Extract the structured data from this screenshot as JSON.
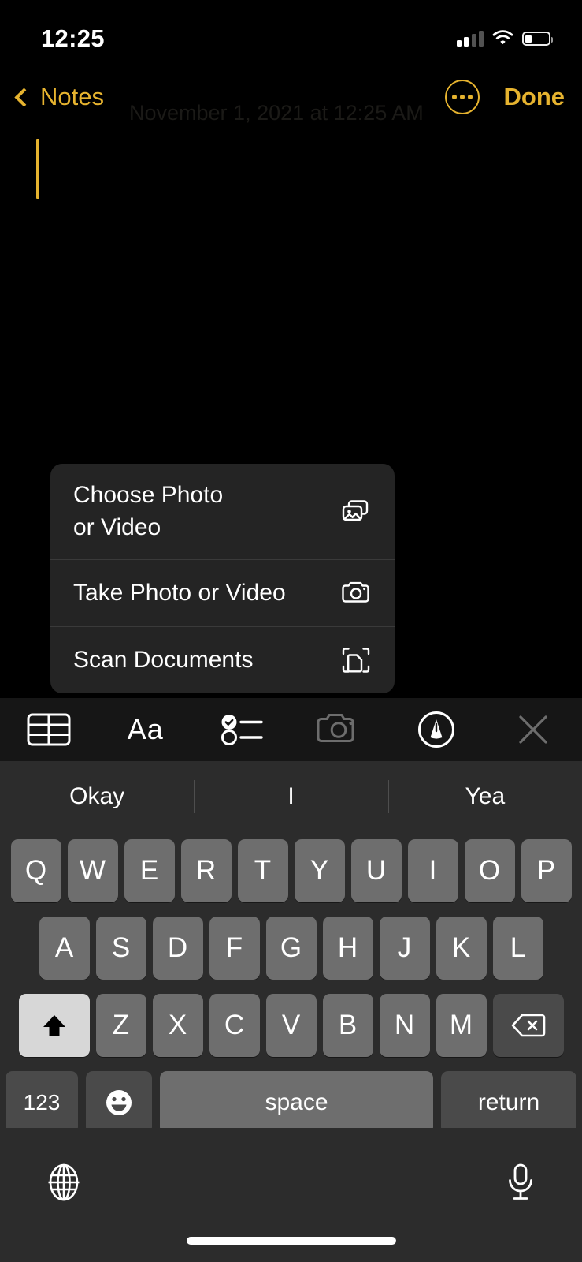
{
  "theme": {
    "accent_color": "#E6B32F",
    "background": "#000000",
    "menu_background": "#242424",
    "key_background": "#6E6E6E",
    "keyboard_background": "#2C2C2C"
  },
  "status_bar": {
    "time": "12:25",
    "cellular_icon": "signal-bars-icon",
    "cellular_bars_filled": 2,
    "cellular_bars_total": 4,
    "wifi_icon": "wifi-icon",
    "battery_icon": "battery-icon",
    "battery_level_percent": 30
  },
  "nav_bar": {
    "back_icon": "chevron-left-icon",
    "back_label": "Notes",
    "more_icon": "ellipsis-circle-icon",
    "done_label": "Done"
  },
  "note": {
    "date_text": "November 1, 2021 at 12:25 AM",
    "body_text": "",
    "caret_visible": true
  },
  "context_menu": {
    "items": [
      {
        "label": "Choose Photo\nor Video",
        "label_line1": "Choose Photo",
        "label_line2": "or Video",
        "icon": "photo-stack-icon",
        "multiline": true
      },
      {
        "label": "Take Photo or Video",
        "icon": "camera-icon",
        "multiline": false
      },
      {
        "label": "Scan Documents",
        "icon": "document-scan-icon",
        "multiline": false
      }
    ]
  },
  "format_toolbar": {
    "items": [
      {
        "name": "table-icon",
        "label": "Table",
        "state": "enabled"
      },
      {
        "name": "text-format-icon",
        "label": "Aa",
        "state": "enabled"
      },
      {
        "name": "checklist-icon",
        "label": "Checklist",
        "state": "enabled"
      },
      {
        "name": "camera-icon",
        "label": "Camera",
        "state": "dimmed"
      },
      {
        "name": "markup-pen-icon",
        "label": "Markup",
        "state": "enabled"
      },
      {
        "name": "close-icon",
        "label": "Close",
        "state": "dimmed"
      }
    ]
  },
  "keyboard": {
    "predictions": [
      "Okay",
      "I",
      "Yea"
    ],
    "row1": [
      "Q",
      "W",
      "E",
      "R",
      "T",
      "Y",
      "U",
      "I",
      "O",
      "P"
    ],
    "row2": [
      "A",
      "S",
      "D",
      "F",
      "G",
      "H",
      "J",
      "K",
      "L"
    ],
    "row3": [
      "Z",
      "X",
      "C",
      "V",
      "B",
      "N",
      "M"
    ],
    "shift_icon": "shift-up-arrow-icon",
    "shift_active": true,
    "delete_icon": "delete-backward-icon",
    "numeric_label": "123",
    "emoji_icon": "smiley-face-icon",
    "space_label": "space",
    "return_label": "return",
    "globe_icon": "globe-icon",
    "mic_icon": "microphone-icon"
  },
  "home_indicator": {
    "name": "home-indicator"
  }
}
